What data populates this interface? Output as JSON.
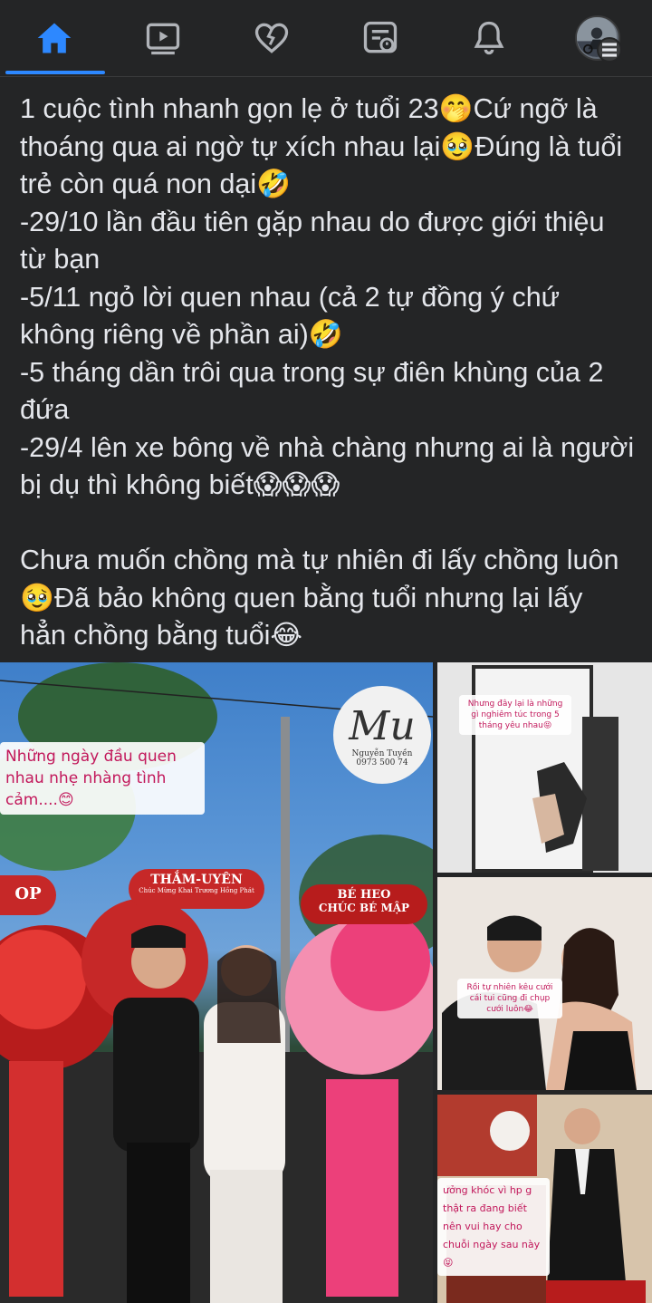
{
  "nav": {
    "items": [
      {
        "name": "home-icon",
        "active": true
      },
      {
        "name": "video-icon",
        "active": false
      },
      {
        "name": "dating-heart-icon",
        "active": false
      },
      {
        "name": "feeds-icon",
        "active": false
      },
      {
        "name": "bell-icon",
        "active": false
      },
      {
        "name": "profile-avatar",
        "active": false
      }
    ],
    "accent_color": "#2d88ff"
  },
  "post": {
    "lines": [
      "1 cuộc tình nhanh gọn lẹ ở tuổi 23🤭Cứ ngỡ là thoáng qua ai ngờ tự xích nhau lại🥹Đúng là tuổi trẻ còn quá non dại🤣",
      "-29/10 lần đầu tiên gặp nhau do được giới thiệu từ bạn",
      "-5/11 ngỏ lời quen nhau (cả 2 tự đồng ý chứ không riêng về phần ai)🤣",
      "-5 tháng dần trôi qua trong sự điên khùng của 2 đứa",
      "-29/4 lên xe bông về nhà chàng nhưng ai là người bị dụ thì không biết😱😱😱"
    ],
    "paragraph2": "Chưa muốn chồng mà tự nhiên đi lấy chồng luôn🥹Đã bảo không quen bằng tuổi nhưng lại lấy hẳn chồng bằng tuổi😂"
  },
  "photos": {
    "main": {
      "caption": "Những ngày đầu quen nhau nhẹ nhàng tình cảm....😊",
      "sign_text": "Mu",
      "sign_sub": "Nguyễn Tuyền",
      "sign_phone": "0973 500 74",
      "banner_left": "THẮM-UYÊN",
      "banner_left_sub": "Chúc Mừng Khai Trương Hồng Phát",
      "banner_right": "BÉ HEO",
      "banner_right_sub": "CHÚC BÉ MẬP",
      "banner_far_left": "OP"
    },
    "top_right": {
      "caption": "Nhưng đây lại là những gì nghiêm túc trong 5 tháng yêu nhau😝"
    },
    "mid_right": {
      "caption": "Rồi tự nhiên kêu cưới cái tui cũng đi chụp cưới luôn😂"
    },
    "bottom_right": {
      "caption": "ưởng khóc vì hp g thật ra đang biết nên vui hay cho chuỗi ngày sau này😝"
    }
  }
}
